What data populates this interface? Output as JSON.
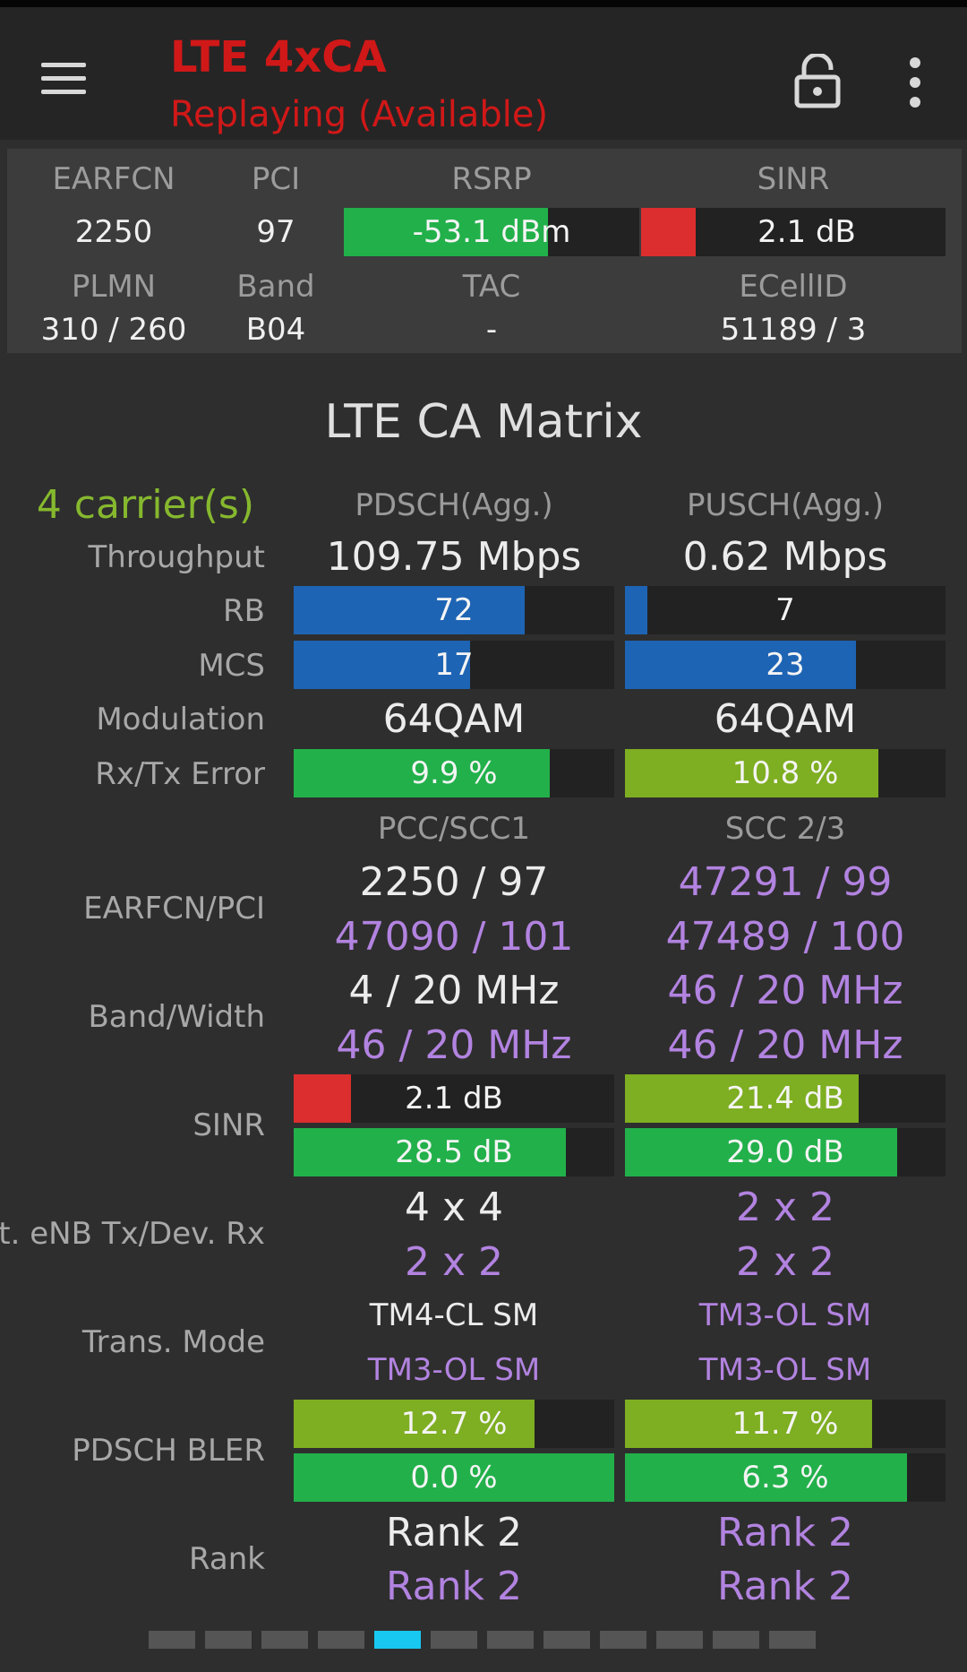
{
  "app": {
    "title": "LTE 4xCA",
    "subtitle": "Replaying (Available)"
  },
  "info": {
    "earfcn_label": "EARFCN",
    "earfcn": "2250",
    "pci_label": "PCI",
    "pci": "97",
    "rsrp_label": "RSRP",
    "rsrp": "-53.1 dBm",
    "rsrp_fill": 0.69,
    "sinr_label": "SINR",
    "sinr": "2.1 dB",
    "sinr_fill": 0.18,
    "plmn_label": "PLMN",
    "plmn": "310 / 260",
    "band_label": "Band",
    "band": "B04",
    "tac_label": "TAC",
    "tac": "-",
    "ecellid_label": "ECellID",
    "ecellid": "51189 / 3"
  },
  "matrix": {
    "title": "LTE CA Matrix",
    "carriers": "4 carrier(s)",
    "pdsch_header": "PDSCH(Agg.)",
    "pusch_header": "PUSCH(Agg.)",
    "labels": {
      "throughput": "Throughput",
      "rb": "RB",
      "mcs": "MCS",
      "modulation": "Modulation",
      "error": "Rx/Tx Error",
      "earfcn_pci": "EARFCN/PCI",
      "band_width": "Band/Width",
      "sinr": "SINR",
      "ant": "Ant. eNB Tx/Dev. Rx",
      "trans_mode": "Trans. Mode",
      "bler": "PDSCH BLER",
      "rank": "Rank"
    },
    "pdsch": {
      "throughput": "109.75 Mbps",
      "rb": "72",
      "rb_fill": 0.72,
      "mcs": "17",
      "mcs_fill": 0.55,
      "modulation": "64QAM",
      "error": "9.9 %",
      "error_fill": 0.8
    },
    "pusch": {
      "throughput": "0.62 Mbps",
      "rb": "7",
      "rb_fill": 0.07,
      "mcs": "23",
      "mcs_fill": 0.72,
      "modulation": "64QAM",
      "error": "10.8 %",
      "error_fill": 0.79
    },
    "pcc_scc1_header": "PCC/SCC1",
    "scc23_header": "SCC 2/3",
    "pcc": {
      "earfcn_pci": "2250 / 97",
      "band_width": "4 / 20 MHz",
      "sinr": "2.1 dB",
      "sinr_fill": 0.18,
      "ant": "4 x 4",
      "trans_mode": "TM4-CL SM",
      "bler": "12.7 %",
      "bler_fill": 0.75,
      "rank": "Rank 2"
    },
    "scc1": {
      "earfcn_pci": "47090 / 101",
      "band_width": "46 / 20 MHz",
      "sinr": "28.5 dB",
      "sinr_fill": 0.85,
      "ant": "2 x 2",
      "trans_mode": "TM3-OL SM",
      "bler": "0.0 %",
      "bler_fill": 1.0,
      "rank": "Rank 2"
    },
    "scc2": {
      "earfcn_pci": "47291 / 99",
      "band_width": "46 / 20 MHz",
      "sinr": "21.4 dB",
      "sinr_fill": 0.73,
      "ant": "2 x 2",
      "trans_mode": "TM3-OL SM",
      "bler": "11.7 %",
      "bler_fill": 0.77,
      "rank": "Rank 2"
    },
    "scc3": {
      "earfcn_pci": "47489 / 100",
      "band_width": "46 / 20 MHz",
      "sinr": "29.0 dB",
      "sinr_fill": 0.85,
      "ant": "2 x 2",
      "trans_mode": "TM3-OL SM",
      "bler": "6.3 %",
      "bler_fill": 0.88,
      "rank": "Rank 2"
    }
  },
  "pager": {
    "count": 12,
    "active_index": 4
  },
  "colors": {
    "title_red": "#d01818",
    "green": "#22b04a",
    "lime": "#7eae21",
    "blue": "#1e64b4",
    "red": "#dc2e2e",
    "purple": "#b283e0",
    "carriers_green": "#86b82e",
    "pager_active": "#18c8f0"
  },
  "icons": {
    "menu": "menu-icon",
    "lock": "lock-open-icon",
    "more": "more-vert-icon"
  }
}
